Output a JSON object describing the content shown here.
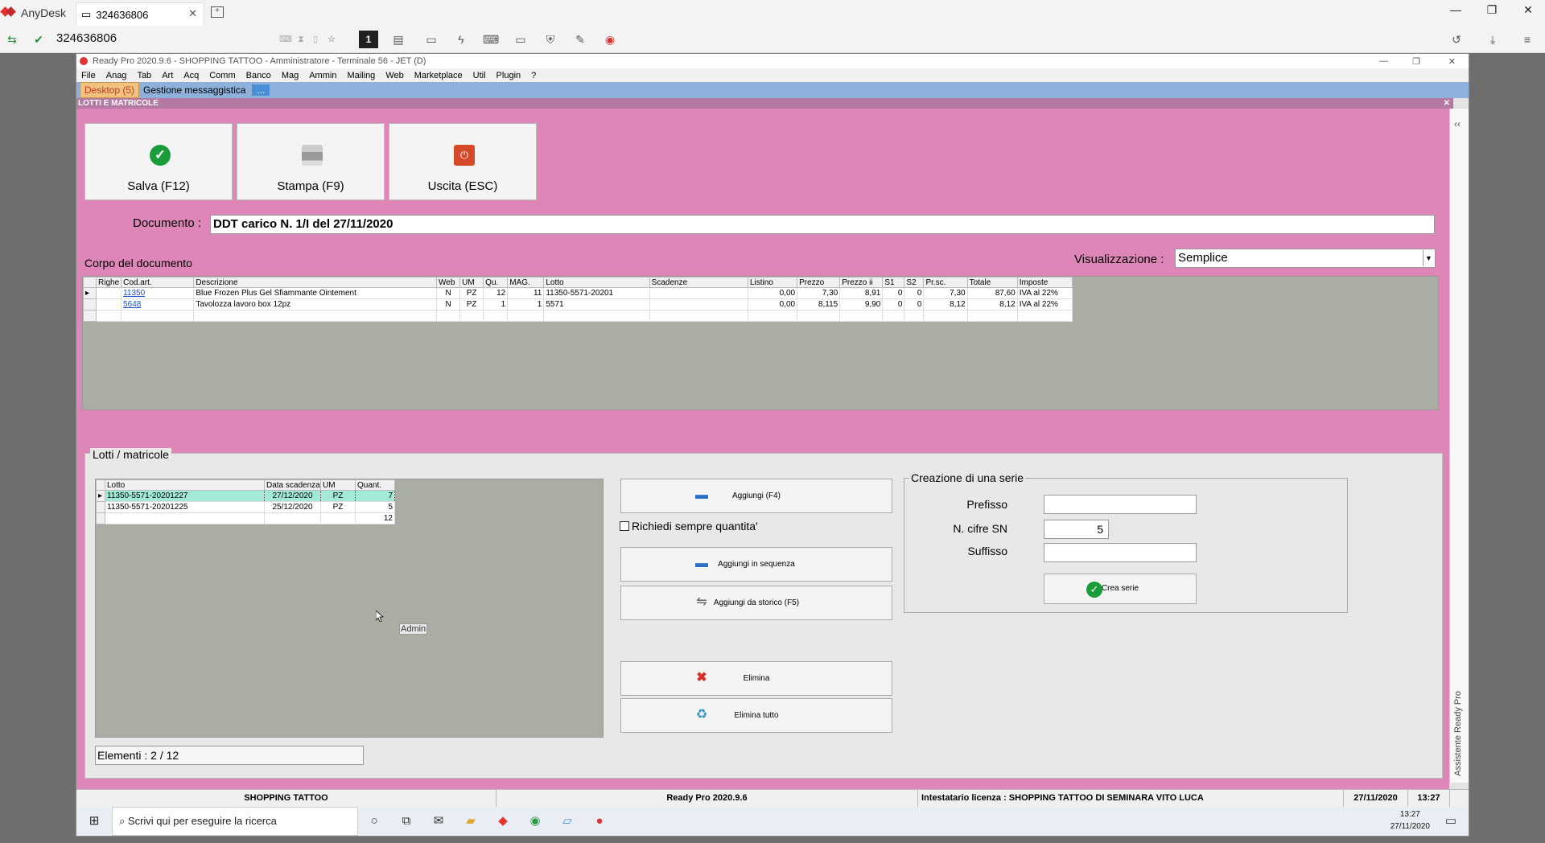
{
  "anydesk": {
    "app_name": "AnyDesk",
    "tab_label": "324636806",
    "address": "324636806",
    "screen_number": "1"
  },
  "window": {
    "title": "Ready Pro 2020.9.6 - SHOPPING TATTOO - Amministratore - Terminale 56 - JET (D)"
  },
  "menu": [
    "File",
    "Anag",
    "Tab",
    "Art",
    "Acq",
    "Comm",
    "Banco",
    "Mag",
    "Ammin",
    "Mailing",
    "Web",
    "Marketplace",
    "Util",
    "Plugin",
    "?"
  ],
  "tabs": {
    "desktop": "Desktop (5)",
    "messaggistica": "Gestione messaggistica",
    "more": "..."
  },
  "panel": {
    "title": "LOTTI E MATRICOLE",
    "close": "✕"
  },
  "toolbar": {
    "save": "Salva (F12)",
    "print": "Stampa (F9)",
    "exit": "Uscita (ESC)"
  },
  "documento": {
    "label": "Documento :",
    "value": "DDT carico N. 1/I del 27/11/2020"
  },
  "corpo": {
    "label": "Corpo del documento",
    "vis_label": "Visualizzazione :",
    "vis_value": "Semplice",
    "columns": [
      "Righe",
      "Cod.art.",
      "Descrizione",
      "Web",
      "UM",
      "Qu.",
      "MAG.",
      "Lotto",
      "Scadenze",
      "Listino",
      "Prezzo",
      "Prezzo ii",
      "S1",
      "S2",
      "Pr.sc.",
      "Totale",
      "Imposte"
    ],
    "rows": [
      {
        "cod": "11350",
        "desc": "Blue Frozen Plus Gel Sfiammante Ointement",
        "web": "N",
        "um": "PZ",
        "qu": "12",
        "mag": "11",
        "lotto": "11350-5571-20201",
        "scad": "",
        "listino": "0,00",
        "prezzo": "7,30",
        "prezzo_ii": "8,91",
        "s1": "0",
        "s2": "0",
        "prsc": "7,30",
        "totale": "87,60",
        "imposte": "IVA al 22%"
      },
      {
        "cod": "5648",
        "desc": "Tavolozza lavoro box 12pz",
        "web": "N",
        "um": "PZ",
        "qu": "1",
        "mag": "1",
        "lotto": "5571",
        "scad": "",
        "listino": "0,00",
        "prezzo": "8,115",
        "prezzo_ii": "9,90",
        "s1": "0",
        "s2": "0",
        "prsc": "8,12",
        "totale": "8,12",
        "imposte": "IVA al 22%"
      }
    ]
  },
  "lotti": {
    "title": "Lotti / matricole",
    "columns": [
      "Lotto",
      "Data scadenza",
      "UM",
      "Quant."
    ],
    "rows": [
      {
        "lotto": "11350-5571-20201227",
        "data": "27/12/2020",
        "um": "PZ",
        "quant": "7"
      },
      {
        "lotto": "11350-5571-20201225",
        "data": "25/12/2020",
        "um": "PZ",
        "quant": "5"
      }
    ],
    "total": "12",
    "elementi": "Elementi : 2 / 12",
    "cursor_tip": "Admin"
  },
  "actions": {
    "aggiungi": "Aggiungi (F4)",
    "richiedi": "Richiedi sempre quantita'",
    "sequenza": "Aggiungi in sequenza",
    "storico": "Aggiungi da storico (F5)",
    "elimina": "Elimina",
    "elimina_tutto": "Elimina tutto"
  },
  "serie": {
    "title": "Creazione di una serie",
    "prefisso_label": "Prefisso",
    "prefisso_value": "",
    "cifre_label": "N. cifre SN",
    "cifre_value": "5",
    "suffisso_label": "Suffisso",
    "suffisso_value": "",
    "crea": "Crea serie"
  },
  "side": {
    "chevron": "‹‹",
    "label": "Assistente Ready Pro"
  },
  "status": {
    "company": "SHOPPING TATTOO",
    "version": "Ready Pro 2020.9.6",
    "license": "Intestatario licenza : SHOPPING TATTOO DI SEMINARA VITO LUCA",
    "date": "27/11/2020",
    "time": "13:27"
  },
  "taskbar": {
    "search_placeholder": "Scrivi qui per eseguire la ricerca",
    "clock_time": "13:27",
    "clock_date": "27/11/2020"
  },
  "colors": {
    "pink_bg": "#df86b9",
    "header_bar": "#b57aa4",
    "tabs_bar": "#8eb1dc",
    "grid_bg": "#aaada3",
    "selected_row": "#a3ead6"
  }
}
